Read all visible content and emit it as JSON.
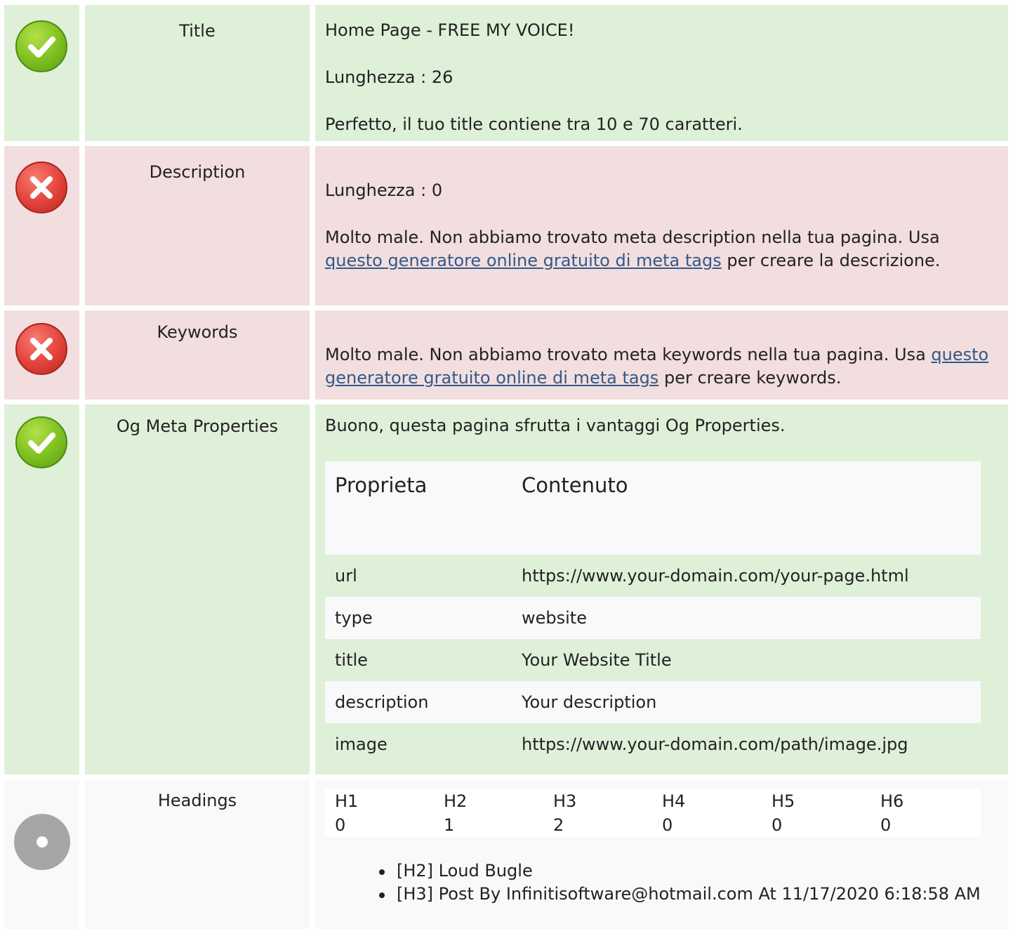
{
  "colors": {
    "ok_bg": "#dff0d8",
    "bad_bg": "#f2dede",
    "neutral_bg": "#f9f9f9",
    "link": "#33598a"
  },
  "rows": {
    "title": {
      "status": "ok",
      "icon": "check-circle-icon",
      "label": "Title",
      "value": "Home Page - FREE MY VOICE!",
      "length": "Lunghezza : 26",
      "message": "Perfetto, il tuo title contiene tra 10 e 70 caratteri."
    },
    "description": {
      "status": "bad",
      "icon": "cross-circle-icon",
      "label": "Description",
      "length": "Lunghezza : 0",
      "message_before": "Molto male. Non abbiamo trovato meta description nella tua pagina. Usa",
      "link_text": "questo generatore online gratuito di meta tags",
      "message_after": "per creare la descrizione."
    },
    "keywords": {
      "status": "bad",
      "icon": "cross-circle-icon",
      "label": "Keywords",
      "message_before": "Molto male. Non abbiamo trovato meta keywords nella tua pagina. Usa",
      "link_text": "questo generatore gratuito online di meta tags",
      "message_after": "per creare keywords."
    },
    "og": {
      "status": "ok",
      "icon": "check-circle-icon",
      "label": "Og Meta Properties",
      "message": "Buono, questa pagina sfrutta i vantaggi Og Properties.",
      "table_headers": [
        "Proprieta",
        "Contenuto"
      ],
      "table_rows": [
        [
          "url",
          "https://www.your-domain.com/your-page.html"
        ],
        [
          "type",
          "website"
        ],
        [
          "title",
          "Your Website Title"
        ],
        [
          "description",
          "Your description"
        ],
        [
          "image",
          "https://www.your-domain.com/path/image.jpg"
        ]
      ]
    },
    "headings": {
      "status": "neutral",
      "icon": "dot-circle-icon",
      "label": "Headings",
      "columns": [
        {
          "tag": "H1",
          "count": "0"
        },
        {
          "tag": "H2",
          "count": "1"
        },
        {
          "tag": "H3",
          "count": "2"
        },
        {
          "tag": "H4",
          "count": "0"
        },
        {
          "tag": "H5",
          "count": "0"
        },
        {
          "tag": "H6",
          "count": "0"
        }
      ],
      "items": [
        "[H2] Loud Bugle",
        "[H3] Post By Infinitisoftware@hotmail.com At 11/17/2020 6:18:58 AM"
      ]
    }
  }
}
